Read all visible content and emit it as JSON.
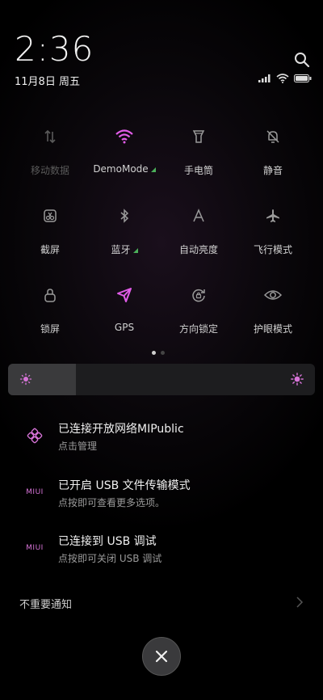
{
  "status": {
    "time": "2:36",
    "date": "11月8日 周五"
  },
  "tiles": [
    {
      "label": "移动数据",
      "icon": "mobile-data-icon",
      "active": false,
      "disabled": true
    },
    {
      "label": "DemoMode",
      "icon": "wifi-icon",
      "active": true,
      "disabled": false
    },
    {
      "label": "手电筒",
      "icon": "flashlight-icon",
      "active": false,
      "disabled": false
    },
    {
      "label": "静音",
      "icon": "mute-bell-icon",
      "active": false,
      "disabled": false
    },
    {
      "label": "截屏",
      "icon": "screenshot-icon",
      "active": false,
      "disabled": false
    },
    {
      "label": "蓝牙",
      "icon": "bluetooth-icon",
      "active": false,
      "disabled": false
    },
    {
      "label": "自动亮度",
      "icon": "auto-brightness-icon",
      "active": false,
      "disabled": false
    },
    {
      "label": "飞行模式",
      "icon": "airplane-icon",
      "active": false,
      "disabled": false
    },
    {
      "label": "锁屏",
      "icon": "lock-icon",
      "active": false,
      "disabled": false
    },
    {
      "label": "GPS",
      "icon": "gps-icon",
      "active": true,
      "disabled": false
    },
    {
      "label": "方向锁定",
      "icon": "rotation-lock-icon",
      "active": false,
      "disabled": false
    },
    {
      "label": "护眼模式",
      "icon": "eye-icon",
      "active": false,
      "disabled": false
    }
  ],
  "brightness": {
    "level": 0.22
  },
  "notifications": [
    {
      "title": "已连接开放网络MIPublic",
      "subtitle": "点击管理",
      "icon": "network-icon"
    },
    {
      "title": "已开启 USB 文件传输模式",
      "subtitle": "点按即可查看更多选项。",
      "icon": "miui-icon",
      "icon_text": "MIUI"
    },
    {
      "title": "已连接到 USB 调试",
      "subtitle": "点按即可关闭 USB 调试",
      "icon": "miui-icon",
      "icon_text": "MIUI"
    }
  ],
  "unimportant_label": "不重要通知",
  "colors": {
    "accent": "#e15ce8",
    "icon_default": "#9a9a9a",
    "miui": "#d774d8",
    "tri": "#4bb05a"
  }
}
